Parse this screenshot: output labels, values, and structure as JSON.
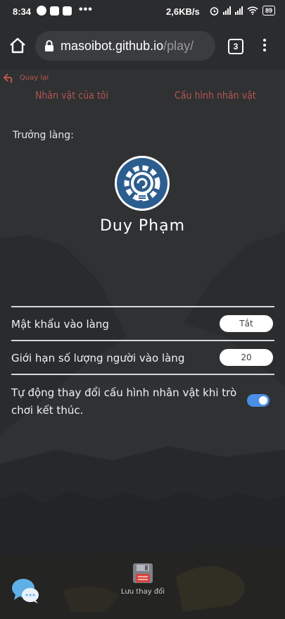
{
  "status_bar": {
    "time": "8:34",
    "dots": "•••",
    "speed": "2,6KB/s",
    "battery": "89"
  },
  "browser": {
    "url_host": "masoibot.github.io",
    "url_path": "/play/",
    "tab_count": "3"
  },
  "nav": {
    "back_label": "Quay lại",
    "tabs": [
      {
        "label": "Nhân vật của tôi"
      },
      {
        "label": "Cấu hình nhân vật"
      }
    ]
  },
  "village": {
    "chief_label": "Trưởng làng:",
    "player_name": "Duy Phạm"
  },
  "settings": {
    "password": {
      "label": "Mật khẩu vào làng",
      "value": "Tắt"
    },
    "limit": {
      "label": "Giới hạn số lượng người vào làng",
      "value": "20"
    },
    "auto_change": {
      "label_line1": "Tự động thay đổi cấu hình nhân vật khi trò",
      "label_line2": "chơi kết thúc.",
      "enabled": true
    }
  },
  "footer": {
    "save_label": "Lưu thay đổi"
  },
  "colors": {
    "accent_red": "#b3564e",
    "toggle_blue": "#4b8ee6",
    "avatar_blue": "#2c5d8f"
  }
}
